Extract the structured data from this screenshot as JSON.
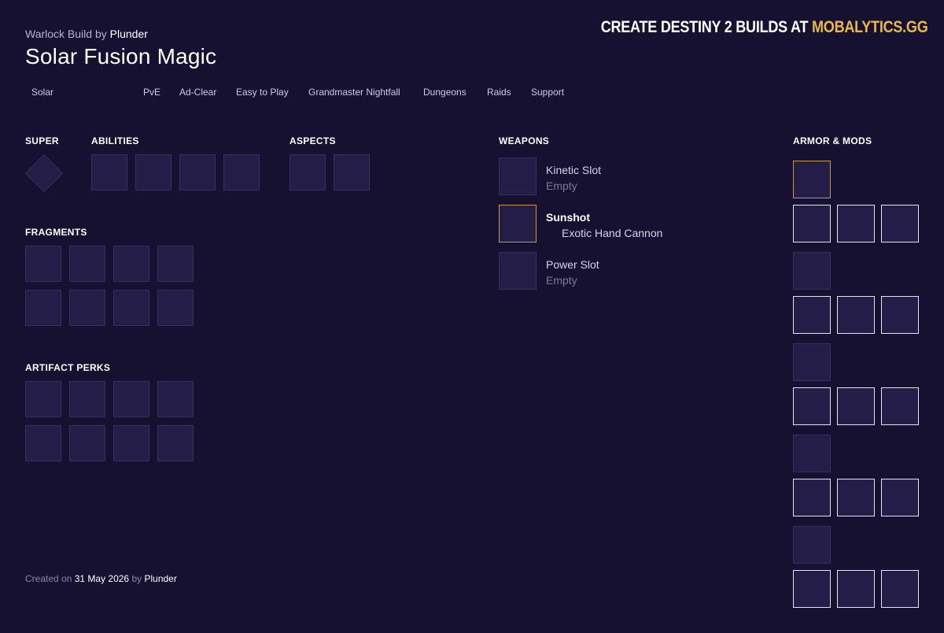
{
  "header": {
    "class_build": "Warlock Build",
    "by": "by",
    "author": "Plunder",
    "title": "Solar Fusion Magic",
    "promo_prefix": "CREATE DESTINY 2 BUILDS AT",
    "promo_brand": "MOBALYTICS.GG"
  },
  "tags": [
    "Solar",
    "PvE",
    "Ad-Clear",
    "Easy to Play",
    "Grandmaster Nightfall",
    "Dungeons",
    "Raids",
    "Support"
  ],
  "sections": {
    "super": "SUPER",
    "abilities": "ABILITIES",
    "aspects": "ASPECTS",
    "fragments": "FRAGMENTS",
    "artifact_perks": "ARTIFACT PERKS",
    "weapons": "WEAPONS",
    "armor_mods": "ARMOR & MODS"
  },
  "weapons": [
    {
      "name": "Kinetic Slot",
      "sub": "Empty"
    },
    {
      "name": "Sunshot",
      "sub": "Exotic Hand Cannon"
    },
    {
      "name": "Power Slot",
      "sub": "Empty"
    }
  ],
  "footer": {
    "created_on": "Created on",
    "date": "31 May 2026",
    "by": "by",
    "author": "Plunder"
  },
  "colors": {
    "background": "#161130",
    "slot_fill": "#231d48",
    "exotic_gold": "#c99a3c",
    "brand_gold": "#e8b84a"
  }
}
